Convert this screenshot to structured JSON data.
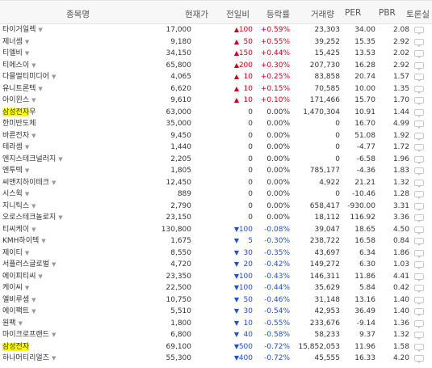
{
  "header": {
    "name": "종목명",
    "price": "현재가",
    "change": "전일비",
    "rate": "등락률",
    "volume": "거래량",
    "per": "PER",
    "pbr": "PBR",
    "talk": "토론실"
  },
  "colors": {
    "up": "#d0021b",
    "down": "#1f4ed4",
    "highlight": "#ffff00"
  },
  "rows": [
    {
      "name": "타이거일렉",
      "hl": "",
      "suffix": "",
      "dd": true,
      "price": "17,000",
      "dir": "up",
      "chg": "100",
      "rate": "+0.59%",
      "vol": "23,303",
      "per": "34.00",
      "pbr": "2.08"
    },
    {
      "name": "제너셈",
      "hl": "",
      "suffix": "",
      "dd": true,
      "price": "9,180",
      "dir": "up",
      "chg": "50",
      "rate": "+0.55%",
      "vol": "39,252",
      "per": "15.35",
      "pbr": "2.92"
    },
    {
      "name": "티엘비",
      "hl": "",
      "suffix": "",
      "dd": true,
      "price": "34,150",
      "dir": "up",
      "chg": "150",
      "rate": "+0.44%",
      "vol": "15,425",
      "per": "13.53",
      "pbr": "2.02"
    },
    {
      "name": "티에스이",
      "hl": "",
      "suffix": "",
      "dd": true,
      "price": "65,800",
      "dir": "up",
      "chg": "200",
      "rate": "+0.30%",
      "vol": "207,730",
      "per": "16.28",
      "pbr": "2.92"
    },
    {
      "name": "다믈멀티미디어",
      "hl": "",
      "suffix": "",
      "dd": true,
      "price": "4,065",
      "dir": "up",
      "chg": "10",
      "rate": "+0.25%",
      "vol": "83,858",
      "per": "20.74",
      "pbr": "1.57"
    },
    {
      "name": "유니트론텍",
      "hl": "",
      "suffix": "",
      "dd": true,
      "price": "6,620",
      "dir": "up",
      "chg": "10",
      "rate": "+0.15%",
      "vol": "70,585",
      "per": "10.00",
      "pbr": "1.35"
    },
    {
      "name": "아이윈스",
      "hl": "",
      "suffix": "",
      "dd": true,
      "price": "9,610",
      "dir": "up",
      "chg": "10",
      "rate": "+0.10%",
      "vol": "171,466",
      "per": "15.70",
      "pbr": "1.70"
    },
    {
      "name": "",
      "hl": "삼성전자",
      "suffix": "우",
      "dd": false,
      "price": "63,000",
      "dir": "flat",
      "chg": "0",
      "rate": "0.00%",
      "vol": "1,470,304",
      "per": "10.91",
      "pbr": "1.44"
    },
    {
      "name": "한미반도체",
      "hl": "",
      "suffix": "",
      "dd": false,
      "price": "35,000",
      "dir": "flat",
      "chg": "0",
      "rate": "0.00%",
      "vol": "0",
      "per": "16.70",
      "pbr": "4.99"
    },
    {
      "name": "바른전자",
      "hl": "",
      "suffix": "",
      "dd": true,
      "price": "9,450",
      "dir": "flat",
      "chg": "0",
      "rate": "0.00%",
      "vol": "0",
      "per": "51.08",
      "pbr": "1.92"
    },
    {
      "name": "테라셈",
      "hl": "",
      "suffix": "",
      "dd": true,
      "price": "1,440",
      "dir": "flat",
      "chg": "0",
      "rate": "0.00%",
      "vol": "0",
      "per": "-4.77",
      "pbr": "1.72"
    },
    {
      "name": "엔지스테크널러지",
      "hl": "",
      "suffix": "",
      "dd": true,
      "price": "2,205",
      "dir": "flat",
      "chg": "0",
      "rate": "0.00%",
      "vol": "0",
      "per": "-6.58",
      "pbr": "1.96"
    },
    {
      "name": "엔투텍",
      "hl": "",
      "suffix": "",
      "dd": true,
      "price": "1,805",
      "dir": "flat",
      "chg": "0",
      "rate": "0.00%",
      "vol": "785,177",
      "per": "-4.36",
      "pbr": "1.83"
    },
    {
      "name": "씨앤지하이테크",
      "hl": "",
      "suffix": "",
      "dd": true,
      "price": "12,450",
      "dir": "flat",
      "chg": "0",
      "rate": "0.00%",
      "vol": "4,922",
      "per": "21.21",
      "pbr": "1.32"
    },
    {
      "name": "시스윅",
      "hl": "",
      "suffix": "",
      "dd": true,
      "price": "889",
      "dir": "flat",
      "chg": "0",
      "rate": "0.00%",
      "vol": "0",
      "per": "-10.46",
      "pbr": "1.28"
    },
    {
      "name": "지니틱스",
      "hl": "",
      "suffix": "",
      "dd": true,
      "price": "2,790",
      "dir": "flat",
      "chg": "0",
      "rate": "0.00%",
      "vol": "658,417",
      "per": "-930.00",
      "pbr": "3.31"
    },
    {
      "name": "오로스테크놀로지",
      "hl": "",
      "suffix": "",
      "dd": true,
      "price": "23,150",
      "dir": "flat",
      "chg": "0",
      "rate": "0.00%",
      "vol": "18,112",
      "per": "116.92",
      "pbr": "3.36"
    },
    {
      "name": "티씨케이",
      "hl": "",
      "suffix": "",
      "dd": true,
      "price": "130,800",
      "dir": "down",
      "chg": "100",
      "rate": "-0.08%",
      "vol": "39,047",
      "per": "18.65",
      "pbr": "4.50"
    },
    {
      "name": "KMH하이텍",
      "hl": "",
      "suffix": "",
      "dd": true,
      "price": "1,675",
      "dir": "down",
      "chg": "5",
      "rate": "-0.30%",
      "vol": "238,722",
      "per": "16.58",
      "pbr": "0.84"
    },
    {
      "name": "제이티",
      "hl": "",
      "suffix": "",
      "dd": true,
      "price": "8,550",
      "dir": "down",
      "chg": "30",
      "rate": "-0.35%",
      "vol": "43,697",
      "per": "6.34",
      "pbr": "1.86"
    },
    {
      "name": "서플러스글로벌",
      "hl": "",
      "suffix": "",
      "dd": true,
      "price": "4,720",
      "dir": "down",
      "chg": "20",
      "rate": "-0.42%",
      "vol": "149,272",
      "per": "6.30",
      "pbr": "1.03"
    },
    {
      "name": "에이피티씨",
      "hl": "",
      "suffix": "",
      "dd": true,
      "price": "23,350",
      "dir": "down",
      "chg": "100",
      "rate": "-0.43%",
      "vol": "146,311",
      "per": "11.86",
      "pbr": "4.41"
    },
    {
      "name": "케이씨",
      "hl": "",
      "suffix": "",
      "dd": true,
      "price": "22,500",
      "dir": "down",
      "chg": "100",
      "rate": "-0.44%",
      "vol": "35,629",
      "per": "5.84",
      "pbr": "0.42"
    },
    {
      "name": "엘비루셈",
      "hl": "",
      "suffix": "",
      "dd": true,
      "price": "10,750",
      "dir": "down",
      "chg": "50",
      "rate": "-0.46%",
      "vol": "31,148",
      "per": "13.16",
      "pbr": "1.40"
    },
    {
      "name": "에이팩트",
      "hl": "",
      "suffix": "",
      "dd": true,
      "price": "5,510",
      "dir": "down",
      "chg": "30",
      "rate": "-0.54%",
      "vol": "42,953",
      "per": "36.49",
      "pbr": "1.40"
    },
    {
      "name": "원팩",
      "hl": "",
      "suffix": "",
      "dd": true,
      "price": "1,800",
      "dir": "down",
      "chg": "10",
      "rate": "-0.55%",
      "vol": "233,676",
      "per": "-9.14",
      "pbr": "1.36"
    },
    {
      "name": "마이크로프랜드",
      "hl": "",
      "suffix": "",
      "dd": true,
      "price": "6,800",
      "dir": "down",
      "chg": "40",
      "rate": "-0.58%",
      "vol": "58,233",
      "per": "9.37",
      "pbr": "1.32"
    },
    {
      "name": "",
      "hl": "삼성전자",
      "suffix": "",
      "dd": false,
      "price": "69,100",
      "dir": "down",
      "chg": "500",
      "rate": "-0.72%",
      "vol": "15,852,053",
      "per": "11.96",
      "pbr": "1.58"
    },
    {
      "name": "하나머티리얼즈",
      "hl": "",
      "suffix": "",
      "dd": true,
      "price": "55,300",
      "dir": "down",
      "chg": "400",
      "rate": "-0.72%",
      "vol": "45,555",
      "per": "16.33",
      "pbr": "4.20"
    }
  ]
}
